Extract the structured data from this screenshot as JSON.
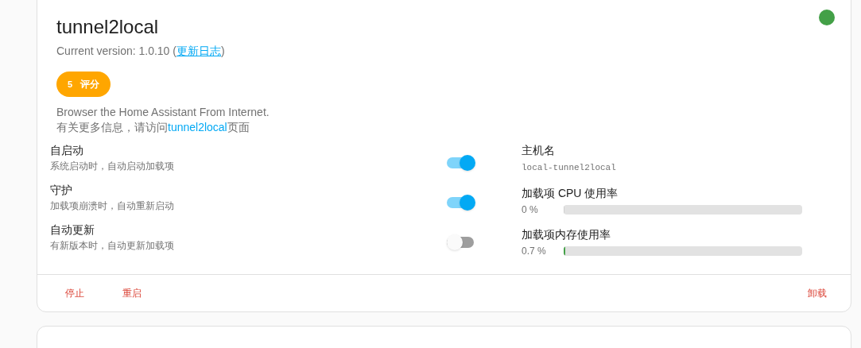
{
  "addon": {
    "title": "tunnel2local",
    "version_label": "Current version: 1.0.10 (",
    "changelog_link": "更新日志",
    "version_suffix": ")",
    "running": true,
    "rating": {
      "value": "5",
      "label": "评分"
    },
    "description": "Browser the Home Assistant From Internet.",
    "more_info": {
      "prefix": "有关更多信息，请访问",
      "link": "tunnel2local",
      "suffix": "页面"
    }
  },
  "options": [
    {
      "title": "自启动",
      "description": "系统启动时，自动启动加载项",
      "on": true
    },
    {
      "title": "守护",
      "description": "加载项崩溃时，自动重新启动",
      "on": true
    },
    {
      "title": "自动更新",
      "description": "有新版本时，自动更新加载项",
      "on": false
    }
  ],
  "hostname": {
    "label": "主机名",
    "value": "local-tunnel2local"
  },
  "metrics": [
    {
      "label": "加载项 CPU 使用率",
      "reading": "0 %",
      "level": 0
    },
    {
      "label": "加载项内存使用率",
      "reading": "0.7 %",
      "level": 0.007
    }
  ],
  "actions": [
    {
      "label": "停止",
      "kind": "left"
    },
    {
      "label": "重启",
      "kind": "left"
    },
    {
      "label": "卸载",
      "kind": "right"
    }
  ]
}
